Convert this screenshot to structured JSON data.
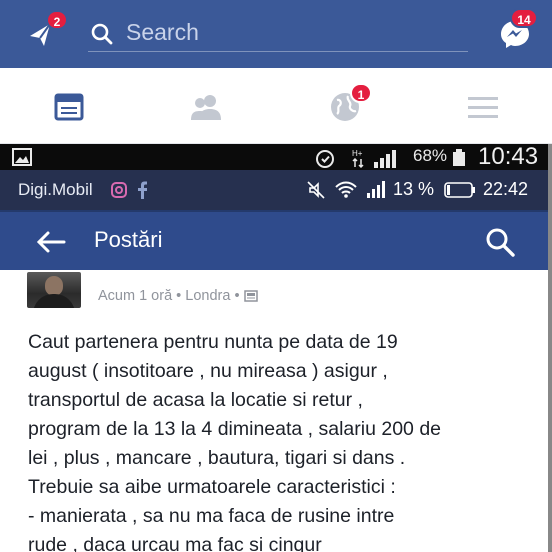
{
  "fb_header": {
    "left_badge": "2",
    "search_placeholder": "Search",
    "right_badge": "14"
  },
  "fb_tabs": {
    "notifications_badge": "1"
  },
  "status_bar_outer": {
    "battery_percent": "68%",
    "time": "10:43"
  },
  "status_bar_inner": {
    "carrier": "Digi.Mobil",
    "battery_percent": "13 %",
    "time": "22:42"
  },
  "app_bar": {
    "title": "Postări"
  },
  "post": {
    "meta": "Acum 1 oră • Londra •",
    "lines": [
      "Caut partenera pentru nunta pe data de 19",
      "august ( insotitoare , nu mireasa ) asigur ,",
      "transportul de acasa la locatie si retur ,",
      "program de la 13 la 4 dimineata , salariu 200 de",
      "lei , plus , mancare , bautura, tigari si dans .",
      "Trebuie sa aibe urmatoarele caracteristici :",
      "- manierata , sa nu ma faca de rusine intre",
      "rude , daca urcau ma fac si cinqur"
    ]
  },
  "colors": {
    "fb_blue": "#3b5998",
    "app_bar_blue": "#2f4b8c",
    "badge_red": "#e41e3f"
  }
}
